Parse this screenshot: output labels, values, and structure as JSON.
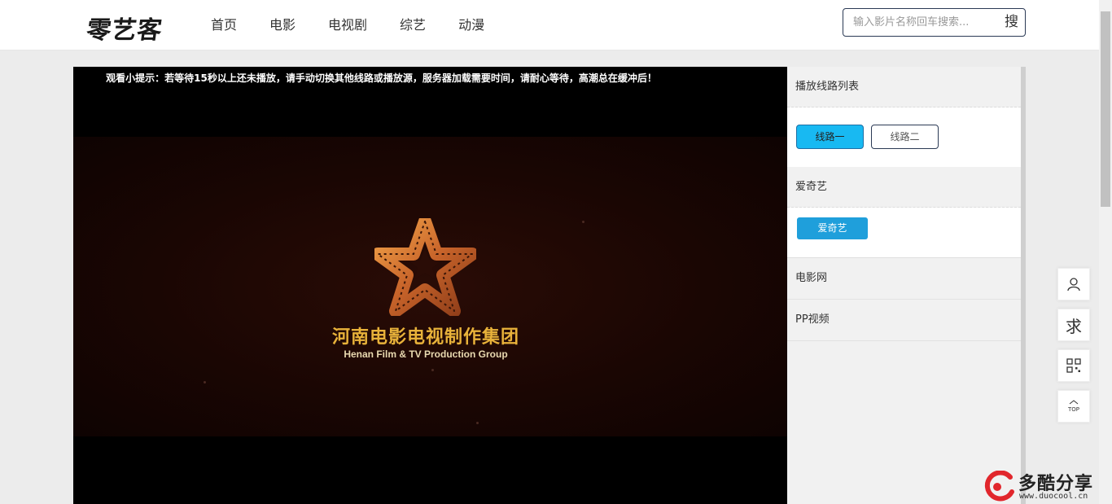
{
  "header": {
    "logo": "零艺客",
    "nav": [
      "首页",
      "电影",
      "电视剧",
      "综艺",
      "动漫"
    ],
    "search_placeholder": "输入影片名称回车搜索...",
    "search_button": "搜"
  },
  "player": {
    "tip": "观看小提示：若等待15秒以上还未播放，请手动切换其他线路或播放源，服务器加载需要时间，请耐心等待，高潮总在缓冲后！",
    "studio_cn": "河南电影电视制作集团",
    "studio_en": "Henan Film & TV Production Group"
  },
  "sidebar": {
    "section1_title": "播放线路列表",
    "lines": [
      "线路一",
      "线路二"
    ],
    "section2_title": "爱奇艺",
    "source_button": "爱奇艺",
    "row3": "电影网",
    "row4": "PP视频"
  },
  "tools": {
    "request": "求",
    "top": "TOP"
  },
  "watermark": {
    "text": "多酷分享",
    "url": "www.duocool.cn"
  },
  "colors": {
    "accent": "#18b9f2",
    "source_button": "#1f9fdb",
    "studio_gold": "#e8b23a"
  },
  "icons": [
    "user-icon",
    "qrcode-icon",
    "arrow-up-icon",
    "star-film-logo"
  ]
}
